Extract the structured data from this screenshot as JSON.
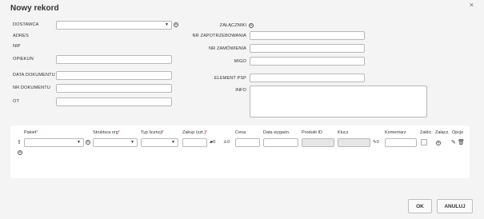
{
  "dialog": {
    "title": "Nowy rekord",
    "close_glyph": "×"
  },
  "left_fields": {
    "dostawca": {
      "label": "DOSTAWCA",
      "value": ""
    },
    "adres": {
      "label": "ADRES",
      "value": ""
    },
    "nip": {
      "label": "NIP",
      "value": ""
    },
    "opiekun": {
      "label": "OPIEKUN",
      "value": ""
    },
    "data_dokumentu": {
      "label": "DATA DOKUMENTU",
      "value": ""
    },
    "nr_dokumentu": {
      "label": "NR DOKUMENTU",
      "value": ""
    },
    "ot": {
      "label": "OT",
      "value": ""
    }
  },
  "right_fields": {
    "zalaczniki": {
      "label": "ZAŁĄCZNIKI"
    },
    "nr_zapotrzebowania": {
      "label": "NR ZAPOTRZEBOWANIA",
      "value": ""
    },
    "nr_zamowienia": {
      "label": "NR ZAMÓWIENIA",
      "value": ""
    },
    "migo": {
      "label": "MIGO",
      "value": ""
    },
    "element_psp": {
      "label": "ELEMENT PSP",
      "value": ""
    },
    "info": {
      "label": "INFO",
      "value": ""
    }
  },
  "table": {
    "headers": {
      "pakiet": "Pakiet",
      "struktura": "Struktura org",
      "typ_licencji": "Typ licencji",
      "zakup": "Zakup (szt.)",
      "cena": "Cena",
      "data_wygasn": "Data wygaśn.",
      "produkt_id": "Produkt ID",
      "klucz": "Klucz",
      "komentarz": "Komentarz",
      "zaklic": "Zaklic",
      "zalacz": "Załącz.",
      "opcje": "Opcje"
    },
    "required_mark": "*",
    "row": {
      "stock_count": "0",
      "user_count": "0",
      "attach_count": "0"
    }
  },
  "buttons": {
    "ok": "OK",
    "anuluj": "ANULUJ"
  },
  "icons": [
    "close-icon",
    "add-circle-icon",
    "chevron-down-icon",
    "arrow-up-icon",
    "car-icon",
    "person-icon",
    "pencil-icon",
    "trash-icon"
  ]
}
